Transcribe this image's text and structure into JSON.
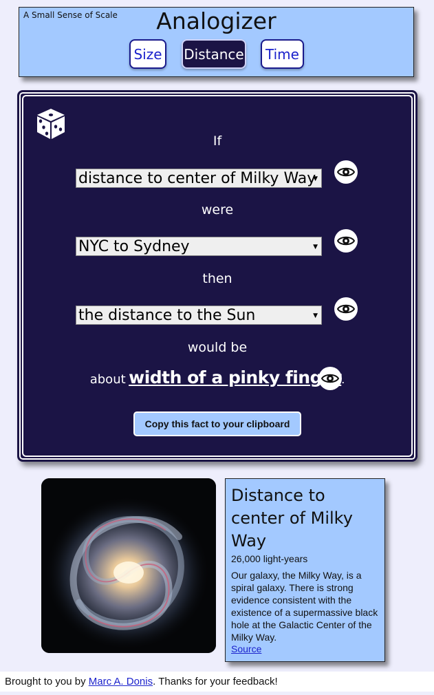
{
  "header": {
    "tagline": "A Small Sense of Scale",
    "title": "Analogizer",
    "tabs": [
      {
        "label": "Size",
        "active": false
      },
      {
        "label": "Distance",
        "active": true
      },
      {
        "label": "Time",
        "active": false
      }
    ]
  },
  "panel": {
    "word_if": "If",
    "select_1": "distance to center of Milky Way",
    "word_were": "were",
    "select_2": "NYC to Sydney",
    "word_then": "then",
    "select_3": "the distance to the Sun",
    "word_would_be": "would be",
    "result_prefix": "about",
    "result_value": "width of a pinky finger",
    "result_suffix": ".",
    "copy_button": "Copy this fact to your clipboard"
  },
  "info": {
    "title": "Distance to center of Milky Way",
    "measure": "26,000 light-years",
    "description": "Our galaxy, the Milky Way, is a spiral galaxy. There is strong evidence consistent with the existence of a supermassive black hole at the Galactic Center of the Milky Way.",
    "source_label": "Source"
  },
  "footer": {
    "prefix": "Brought to you by ",
    "author": "Marc A. Donis",
    "suffix": ". Thanks for your feedback!"
  },
  "icons": [
    "dice-icon",
    "eye-icon",
    "chevron-down-icon"
  ],
  "colors": {
    "header_bg": "#a3c9ff",
    "panel_bg": "#1b1445",
    "page_bg": "#eeeefc",
    "link": "#1b22cc"
  }
}
